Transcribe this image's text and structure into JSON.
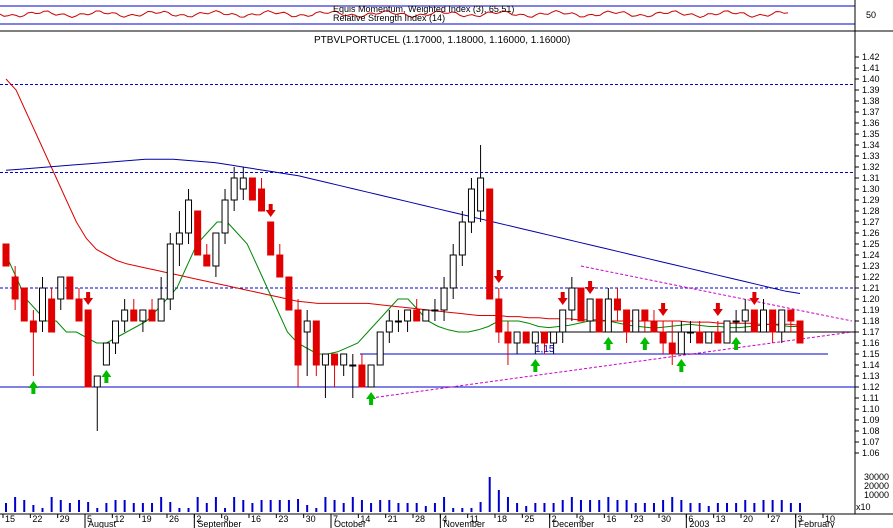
{
  "indicator_panel": {
    "title": "Equis  Momentum, Weighted  Index (3),  65.51)",
    "subtitle": "Relative Strength Index (14)",
    "level": "50",
    "line_color": "#cc0000"
  },
  "chart_data": {
    "type": "candlestick",
    "title": "PTBVLPORTUCEL (1.17000, 1.18000, 1.16000, 1.16000)",
    "ylim": [
      1.05,
      1.43
    ],
    "y_ticks": [
      1.06,
      1.07,
      1.08,
      1.09,
      1.1,
      1.11,
      1.12,
      1.13,
      1.14,
      1.15,
      1.16,
      1.17,
      1.18,
      1.19,
      1.2,
      1.21,
      1.22,
      1.23,
      1.24,
      1.25,
      1.26,
      1.27,
      1.28,
      1.29,
      1.3,
      1.31,
      1.32,
      1.33,
      1.34,
      1.35,
      1.36,
      1.37,
      1.38,
      1.39,
      1.4,
      1.41,
      1.42
    ],
    "x_day_labels": [
      "15",
      "22",
      "29",
      "5",
      "12",
      "19",
      "26",
      "2",
      "9",
      "16",
      "23",
      "30",
      "7",
      "14",
      "21",
      "28",
      "4",
      "11",
      "18",
      "25",
      "2",
      "9",
      "16",
      "23",
      "30",
      "6",
      "13",
      "20",
      "27",
      "3",
      "10"
    ],
    "x_month_labels": [
      "August",
      "September",
      "October",
      "November",
      "December",
      "2003",
      "February"
    ],
    "annotation": "1,15",
    "horizontal_levels": [
      1.12,
      1.15,
      1.17,
      1.21,
      1.315,
      1.395
    ],
    "volume_ticks": [
      "30000",
      "20000",
      "10000"
    ],
    "volume_unit": "x10",
    "colors": {
      "up": "#000000",
      "down": "#e00000",
      "ma_fast": "#008800",
      "ma_mid": "#dd0000",
      "ma_slow": "#0000aa",
      "trend": "#cc00cc",
      "buy": "#00bb00",
      "sell": "#dd0000",
      "volume": "#0000cc"
    },
    "candles": [
      {
        "o": 1.25,
        "h": 1.25,
        "l": 1.23,
        "c": 1.23
      },
      {
        "o": 1.22,
        "h": 1.23,
        "l": 1.19,
        "c": 1.2
      },
      {
        "o": 1.21,
        "h": 1.21,
        "l": 1.18,
        "c": 1.18
      },
      {
        "o": 1.18,
        "h": 1.19,
        "l": 1.13,
        "c": 1.17
      },
      {
        "o": 1.18,
        "h": 1.22,
        "l": 1.17,
        "c": 1.21
      },
      {
        "o": 1.2,
        "h": 1.21,
        "l": 1.17,
        "c": 1.17
      },
      {
        "o": 1.2,
        "h": 1.22,
        "l": 1.19,
        "c": 1.22
      },
      {
        "o": 1.22,
        "h": 1.22,
        "l": 1.2,
        "c": 1.2
      },
      {
        "o": 1.2,
        "h": 1.21,
        "l": 1.18,
        "c": 1.18
      },
      {
        "o": 1.19,
        "h": 1.19,
        "l": 1.12,
        "c": 1.12
      },
      {
        "o": 1.12,
        "h": 1.13,
        "l": 1.08,
        "c": 1.13
      },
      {
        "o": 1.14,
        "h": 1.16,
        "l": 1.14,
        "c": 1.16
      },
      {
        "o": 1.16,
        "h": 1.18,
        "l": 1.15,
        "c": 1.18
      },
      {
        "o": 1.18,
        "h": 1.2,
        "l": 1.17,
        "c": 1.19
      },
      {
        "o": 1.19,
        "h": 1.2,
        "l": 1.18,
        "c": 1.18
      },
      {
        "o": 1.18,
        "h": 1.19,
        "l": 1.17,
        "c": 1.19
      },
      {
        "o": 1.19,
        "h": 1.2,
        "l": 1.18,
        "c": 1.18
      },
      {
        "o": 1.18,
        "h": 1.22,
        "l": 1.18,
        "c": 1.2
      },
      {
        "o": 1.2,
        "h": 1.26,
        "l": 1.19,
        "c": 1.25
      },
      {
        "o": 1.25,
        "h": 1.28,
        "l": 1.23,
        "c": 1.26
      },
      {
        "o": 1.26,
        "h": 1.3,
        "l": 1.25,
        "c": 1.29
      },
      {
        "o": 1.28,
        "h": 1.28,
        "l": 1.24,
        "c": 1.24
      },
      {
        "o": 1.24,
        "h": 1.25,
        "l": 1.23,
        "c": 1.23
      },
      {
        "o": 1.23,
        "h": 1.26,
        "l": 1.22,
        "c": 1.26
      },
      {
        "o": 1.26,
        "h": 1.3,
        "l": 1.25,
        "c": 1.29
      },
      {
        "o": 1.29,
        "h": 1.32,
        "l": 1.28,
        "c": 1.31
      },
      {
        "o": 1.3,
        "h": 1.32,
        "l": 1.29,
        "c": 1.31
      },
      {
        "o": 1.31,
        "h": 1.31,
        "l": 1.29,
        "c": 1.29
      },
      {
        "o": 1.3,
        "h": 1.31,
        "l": 1.28,
        "c": 1.28
      },
      {
        "o": 1.27,
        "h": 1.27,
        "l": 1.24,
        "c": 1.24
      },
      {
        "o": 1.24,
        "h": 1.25,
        "l": 1.22,
        "c": 1.22
      },
      {
        "o": 1.22,
        "h": 1.22,
        "l": 1.19,
        "c": 1.19
      },
      {
        "o": 1.19,
        "h": 1.2,
        "l": 1.12,
        "c": 1.14
      },
      {
        "o": 1.17,
        "h": 1.19,
        "l": 1.13,
        "c": 1.18
      },
      {
        "o": 1.18,
        "h": 1.18,
        "l": 1.13,
        "c": 1.14
      },
      {
        "o": 1.14,
        "h": 1.15,
        "l": 1.11,
        "c": 1.15
      },
      {
        "o": 1.15,
        "h": 1.15,
        "l": 1.12,
        "c": 1.14
      },
      {
        "o": 1.14,
        "h": 1.15,
        "l": 1.13,
        "c": 1.15
      },
      {
        "o": 1.14,
        "h": 1.15,
        "l": 1.11,
        "c": 1.14
      },
      {
        "o": 1.14,
        "h": 1.15,
        "l": 1.12,
        "c": 1.12
      },
      {
        "o": 1.12,
        "h": 1.14,
        "l": 1.12,
        "c": 1.14
      },
      {
        "o": 1.14,
        "h": 1.17,
        "l": 1.14,
        "c": 1.17
      },
      {
        "o": 1.17,
        "h": 1.19,
        "l": 1.16,
        "c": 1.18
      },
      {
        "o": 1.18,
        "h": 1.19,
        "l": 1.17,
        "c": 1.18
      },
      {
        "o": 1.18,
        "h": 1.19,
        "l": 1.17,
        "c": 1.19
      },
      {
        "o": 1.19,
        "h": 1.2,
        "l": 1.18,
        "c": 1.18
      },
      {
        "o": 1.18,
        "h": 1.19,
        "l": 1.18,
        "c": 1.19
      },
      {
        "o": 1.19,
        "h": 1.2,
        "l": 1.18,
        "c": 1.19
      },
      {
        "o": 1.19,
        "h": 1.22,
        "l": 1.18,
        "c": 1.21
      },
      {
        "o": 1.21,
        "h": 1.25,
        "l": 1.2,
        "c": 1.24
      },
      {
        "o": 1.24,
        "h": 1.28,
        "l": 1.23,
        "c": 1.27
      },
      {
        "o": 1.27,
        "h": 1.31,
        "l": 1.26,
        "c": 1.3
      },
      {
        "o": 1.28,
        "h": 1.34,
        "l": 1.27,
        "c": 1.31
      },
      {
        "o": 1.3,
        "h": 1.3,
        "l": 1.2,
        "c": 1.2
      },
      {
        "o": 1.2,
        "h": 1.21,
        "l": 1.16,
        "c": 1.17
      },
      {
        "o": 1.17,
        "h": 1.18,
        "l": 1.14,
        "c": 1.16
      },
      {
        "o": 1.16,
        "h": 1.17,
        "l": 1.15,
        "c": 1.17
      },
      {
        "o": 1.17,
        "h": 1.17,
        "l": 1.16,
        "c": 1.16
      },
      {
        "o": 1.16,
        "h": 1.17,
        "l": 1.15,
        "c": 1.17
      },
      {
        "o": 1.17,
        "h": 1.17,
        "l": 1.15,
        "c": 1.16
      },
      {
        "o": 1.16,
        "h": 1.17,
        "l": 1.15,
        "c": 1.17
      },
      {
        "o": 1.17,
        "h": 1.19,
        "l": 1.16,
        "c": 1.19
      },
      {
        "o": 1.19,
        "h": 1.22,
        "l": 1.18,
        "c": 1.21
      },
      {
        "o": 1.21,
        "h": 1.21,
        "l": 1.18,
        "c": 1.18
      },
      {
        "o": 1.18,
        "h": 1.2,
        "l": 1.17,
        "c": 1.2
      },
      {
        "o": 1.2,
        "h": 1.2,
        "l": 1.17,
        "c": 1.17
      },
      {
        "o": 1.17,
        "h": 1.21,
        "l": 1.17,
        "c": 1.2
      },
      {
        "o": 1.2,
        "h": 1.21,
        "l": 1.18,
        "c": 1.19
      },
      {
        "o": 1.19,
        "h": 1.19,
        "l": 1.16,
        "c": 1.17
      },
      {
        "o": 1.17,
        "h": 1.19,
        "l": 1.17,
        "c": 1.19
      },
      {
        "o": 1.19,
        "h": 1.19,
        "l": 1.17,
        "c": 1.18
      },
      {
        "o": 1.18,
        "h": 1.19,
        "l": 1.17,
        "c": 1.17
      },
      {
        "o": 1.17,
        "h": 1.18,
        "l": 1.15,
        "c": 1.16
      },
      {
        "o": 1.16,
        "h": 1.18,
        "l": 1.14,
        "c": 1.15
      },
      {
        "o": 1.15,
        "h": 1.18,
        "l": 1.15,
        "c": 1.17
      },
      {
        "o": 1.17,
        "h": 1.18,
        "l": 1.16,
        "c": 1.17
      },
      {
        "o": 1.17,
        "h": 1.18,
        "l": 1.16,
        "c": 1.16
      },
      {
        "o": 1.16,
        "h": 1.17,
        "l": 1.16,
        "c": 1.17
      },
      {
        "o": 1.17,
        "h": 1.18,
        "l": 1.16,
        "c": 1.16
      },
      {
        "o": 1.16,
        "h": 1.18,
        "l": 1.16,
        "c": 1.18
      },
      {
        "o": 1.18,
        "h": 1.19,
        "l": 1.17,
        "c": 1.18
      },
      {
        "o": 1.18,
        "h": 1.2,
        "l": 1.17,
        "c": 1.19
      },
      {
        "o": 1.19,
        "h": 1.19,
        "l": 1.17,
        "c": 1.17
      },
      {
        "o": 1.17,
        "h": 1.2,
        "l": 1.17,
        "c": 1.19
      },
      {
        "o": 1.19,
        "h": 1.19,
        "l": 1.16,
        "c": 1.17
      },
      {
        "o": 1.17,
        "h": 1.19,
        "l": 1.16,
        "c": 1.19
      },
      {
        "o": 1.19,
        "h": 1.19,
        "l": 1.17,
        "c": 1.18
      },
      {
        "o": 1.18,
        "h": 1.18,
        "l": 1.16,
        "c": 1.16
      }
    ],
    "ma_fast": [
      1.24,
      1.22,
      1.2,
      1.19,
      1.18,
      1.18,
      1.17,
      1.17,
      1.165,
      1.16,
      1.16,
      1.165,
      1.17,
      1.175,
      1.18,
      1.19,
      1.2,
      1.21,
      1.23,
      1.25,
      1.26,
      1.27,
      1.27,
      1.26,
      1.25,
      1.23,
      1.21,
      1.19,
      1.17,
      1.16,
      1.155,
      1.15,
      1.15,
      1.152,
      1.156,
      1.16,
      1.17,
      1.18,
      1.19,
      1.2,
      1.2,
      1.19,
      1.18,
      1.175,
      1.172,
      1.17,
      1.17,
      1.172,
      1.175,
      1.18,
      1.18,
      1.18,
      1.178,
      1.175,
      1.174,
      1.175,
      1.176,
      1.178,
      1.18,
      1.18,
      1.18,
      1.178,
      1.176,
      1.175,
      1.174,
      1.174,
      1.175,
      1.176,
      1.177,
      1.176,
      1.175,
      1.175,
      1.174,
      1.174,
      1.175,
      1.176,
      1.177,
      1.176,
      1.175,
      1.175
    ],
    "ma_mid": [
      1.4,
      1.39,
      1.37,
      1.35,
      1.33,
      1.31,
      1.29,
      1.27,
      1.255,
      1.245,
      1.24,
      1.235,
      1.232,
      1.23,
      1.228,
      1.226,
      1.224,
      1.222,
      1.22,
      1.218,
      1.216,
      1.214,
      1.212,
      1.21,
      1.208,
      1.206,
      1.204,
      1.202,
      1.2,
      1.198,
      1.197,
      1.196,
      1.196,
      1.196,
      1.196,
      1.196,
      1.196,
      1.195,
      1.194,
      1.193,
      1.192,
      1.191,
      1.19,
      1.189,
      1.188,
      1.187,
      1.186,
      1.185,
      1.185,
      1.185,
      1.184,
      1.184,
      1.183,
      1.183,
      1.182,
      1.182,
      1.182,
      1.181,
      1.181,
      1.181,
      1.18,
      1.18,
      1.18,
      1.18,
      1.18,
      1.18,
      1.18,
      1.18,
      1.179,
      1.179,
      1.179,
      1.178,
      1.178,
      1.178,
      1.178,
      1.177,
      1.177,
      1.177,
      1.177,
      1.176
    ],
    "ma_slow": [
      1.317,
      1.318,
      1.319,
      1.32,
      1.321,
      1.322,
      1.323,
      1.324,
      1.325,
      1.326,
      1.327,
      1.327,
      1.327,
      1.326,
      1.325,
      1.324,
      1.322,
      1.32,
      1.318,
      1.316,
      1.314,
      1.312,
      1.309,
      1.306,
      1.303,
      1.3,
      1.297,
      1.294,
      1.291,
      1.288,
      1.285,
      1.282,
      1.279,
      1.276,
      1.273,
      1.27,
      1.267,
      1.264,
      1.261,
      1.258,
      1.255,
      1.252,
      1.249,
      1.246,
      1.243,
      1.24,
      1.237,
      1.234,
      1.231,
      1.228,
      1.225,
      1.222,
      1.219,
      1.216,
      1.213,
      1.21,
      1.207,
      1.205
    ],
    "buy_signals": [
      3,
      11,
      40,
      58,
      66,
      70,
      74,
      80
    ],
    "sell_signals": [
      9,
      29,
      54,
      61,
      64,
      72,
      78,
      82
    ]
  }
}
